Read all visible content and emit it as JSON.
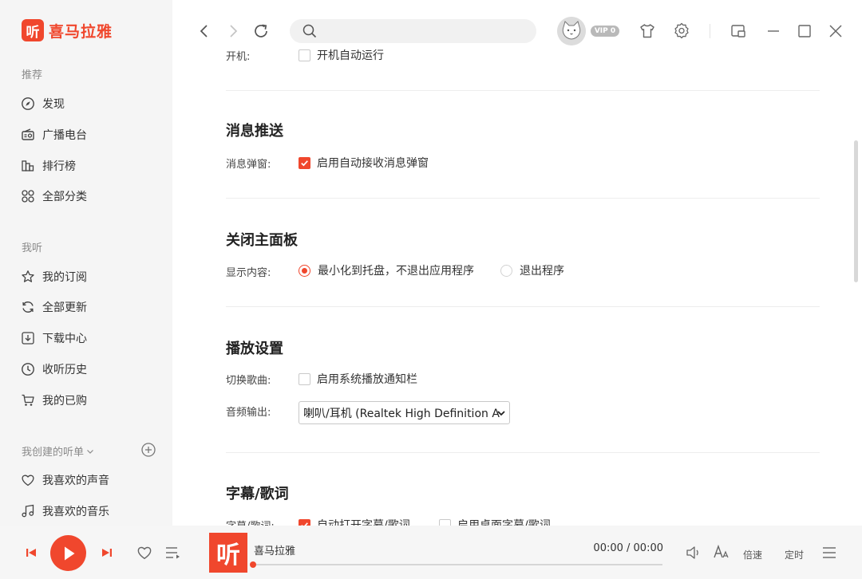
{
  "colors": {
    "accent": "#f0472d",
    "sidebar_bg": "#f5f5f5"
  },
  "app": {
    "name": "喜马拉雅",
    "logo_char": "听"
  },
  "sidebar": {
    "sections": [
      {
        "title": "推荐",
        "items": [
          {
            "label": "发现",
            "icon": "compass-icon"
          },
          {
            "label": "广播电台",
            "icon": "radio-icon"
          },
          {
            "label": "排行榜",
            "icon": "ranking-icon"
          },
          {
            "label": "全部分类",
            "icon": "grid-icon"
          }
        ]
      },
      {
        "title": "我听",
        "items": [
          {
            "label": "我的订阅",
            "icon": "star-icon"
          },
          {
            "label": "全部更新",
            "icon": "refresh-icon"
          },
          {
            "label": "下载中心",
            "icon": "download-icon"
          },
          {
            "label": "收听历史",
            "icon": "clock-icon"
          },
          {
            "label": "我的已购",
            "icon": "cart-icon"
          }
        ]
      },
      {
        "title": "我创建的听单",
        "items": [
          {
            "label": "我喜欢的声音",
            "icon": "heart-icon"
          },
          {
            "label": "我喜欢的音乐",
            "icon": "music-note-icon"
          }
        ]
      }
    ]
  },
  "topbar": {
    "search_placeholder": "",
    "vip_badge": "VIP 0"
  },
  "settings": {
    "startup": {
      "label": "开机:",
      "option": "开机自动运行",
      "checked": false
    },
    "push": {
      "heading": "消息推送",
      "label": "消息弹窗:",
      "option": "启用自动接收消息弹窗",
      "checked": true
    },
    "close_panel": {
      "heading": "关闭主面板",
      "label": "显示内容:",
      "options": [
        {
          "label": "最小化到托盘，不退出应用程序",
          "selected": true
        },
        {
          "label": "退出程序",
          "selected": false
        }
      ]
    },
    "playback": {
      "heading": "播放设置",
      "switch_label": "切换歌曲:",
      "switch_option": "启用系统播放通知栏",
      "switch_checked": false,
      "output_label": "音频输出:",
      "output_value": "喇叭/耳机 (Realtek High Definition A"
    },
    "lyrics": {
      "heading": "字幕/歌词",
      "label": "字幕/歌词:",
      "options": [
        {
          "label": "自动打开字幕/歌词",
          "checked": true
        },
        {
          "label": "启用桌面字幕/歌词",
          "checked": false
        }
      ]
    }
  },
  "player": {
    "cover_char": "听",
    "title": "喜马拉雅",
    "time": "00:00 / 00:00",
    "progress": 0,
    "speed_label": "倍速",
    "timer_label": "定时"
  }
}
